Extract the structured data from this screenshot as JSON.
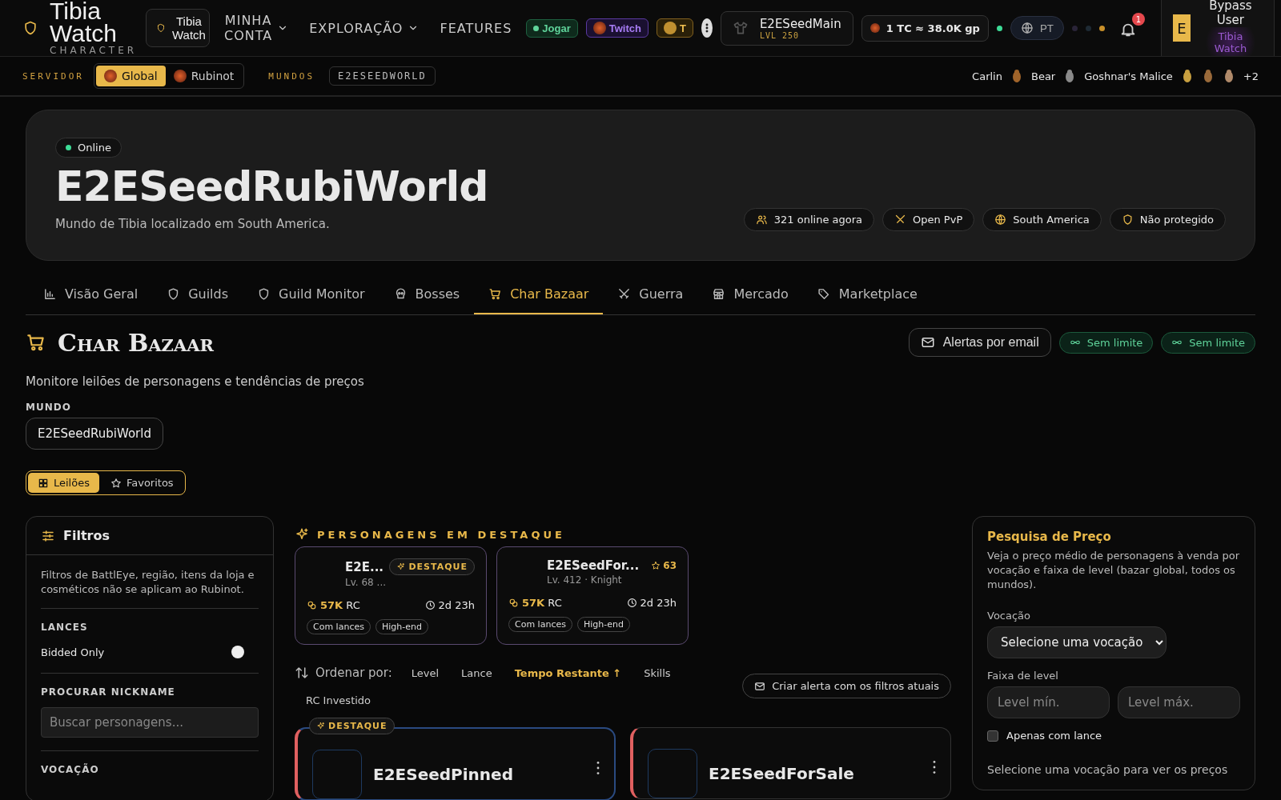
{
  "topbar": {
    "logo_title": "Tibia Watch",
    "logo_subtitle": "CHARACTER",
    "site_switch": "Tibia Watch",
    "nav": [
      {
        "label": "MINHA CONTA",
        "dropdown": true
      },
      {
        "label": "EXPLORAÇÃO",
        "dropdown": true
      },
      {
        "label": "FEATURES",
        "dropdown": false
      }
    ],
    "pills": [
      {
        "label": "Jogar",
        "kind": "jogar"
      },
      {
        "label": "Twitch",
        "kind": "twitch"
      },
      {
        "label": "T",
        "kind": "discord"
      }
    ],
    "character": {
      "name": "E2ESeedMain",
      "level": "LVL 250"
    },
    "tc_rate": "1 TC ≈ 38.0K gp",
    "language": "PT",
    "notifications": "1",
    "user": {
      "initial": "E",
      "name": "Bypass User",
      "brand": "Tibia Watch"
    }
  },
  "subbar": {
    "server_label": "SERVIDOR",
    "servers": [
      {
        "label": "Global",
        "selected": true
      },
      {
        "label": "Rubinot",
        "selected": false
      }
    ],
    "worlds_label": "MUNDOS",
    "world": "E2ESEEDWORLD",
    "bosses": [
      {
        "kind": "text",
        "name": "Carlin"
      },
      {
        "kind": "creature",
        "name": "Bear",
        "color": "#a0642a"
      },
      {
        "kind": "creature",
        "name": "Goshnar's Malice",
        "color": "#8a8a8a"
      },
      {
        "kind": "creature",
        "color": "#c8a040"
      },
      {
        "kind": "creature",
        "color": "#9a6a3a"
      },
      {
        "kind": "creature",
        "color": "#b08a6a"
      },
      {
        "kind": "text",
        "name": "+2"
      }
    ]
  },
  "hero": {
    "status": "Online",
    "title": "E2ESeedRubiWorld",
    "subtitle": "Mundo de Tibia localizado em South America.",
    "badges": [
      {
        "kind": "players",
        "label": "321 online agora"
      },
      {
        "kind": "pvp",
        "label": "Open PvP"
      },
      {
        "kind": "globe",
        "label": "South America"
      },
      {
        "kind": "shield",
        "label": "Não protegido"
      }
    ]
  },
  "tabs": [
    {
      "kind": "chart",
      "label": "Visão Geral",
      "selected": false
    },
    {
      "kind": "shield",
      "label": "Guilds",
      "selected": false
    },
    {
      "kind": "shield",
      "label": "Guild Monitor",
      "selected": false
    },
    {
      "kind": "skull",
      "label": "Bosses",
      "selected": false
    },
    {
      "kind": "cart",
      "label": "Char Bazaar",
      "selected": true
    },
    {
      "kind": "swords",
      "label": "Guerra",
      "selected": false
    },
    {
      "kind": "store",
      "label": "Mercado",
      "selected": false
    },
    {
      "kind": "tag",
      "label": "Marketplace",
      "selected": false
    }
  ],
  "bazaar": {
    "title": "Char Bazaar",
    "description": "Monitore leilões de personagens e tendências de preços",
    "email_button": "Alertas por email",
    "limits": [
      "Sem limite",
      "Sem limite"
    ],
    "world_label": "MUNDO",
    "world_value": "E2ESeedRubiWorld",
    "views": [
      {
        "kind": "grid",
        "label": "Leilões",
        "selected": true
      },
      {
        "kind": "star",
        "label": "Favoritos",
        "selected": false
      }
    ]
  },
  "filters": {
    "title": "Filtros",
    "note": "Filtros de BattlEye, região, itens da loja e cosméticos não se aplicam ao Rubinot.",
    "bids_label": "LANCES",
    "bidded_only": {
      "label": "Bidded Only",
      "on": false
    },
    "nickname_label": "PROCURAR NICKNAME",
    "nickname_placeholder": "Buscar personagens...",
    "vocation_label": "VOCAÇÃO"
  },
  "featured": {
    "heading": "PERSONAGENS EM DESTAQUE",
    "cards": [
      {
        "name": "E2E...",
        "info": "Lv. 68 ...",
        "badge": "DESTAQUE",
        "price": "57K",
        "currency": "RC",
        "time": "2d 23h",
        "tags": [
          "Com lances",
          "High-end"
        ]
      },
      {
        "name": "E2ESeedFor...",
        "info": "Lv. 412 · Knight",
        "score": "63",
        "price": "57K",
        "currency": "RC",
        "time": "2d 23h",
        "tags": [
          "Com lances",
          "High-end"
        ]
      }
    ]
  },
  "sort": {
    "label": "Ordenar por:",
    "options": [
      {
        "label": "Level",
        "selected": false
      },
      {
        "label": "Lance",
        "selected": false
      },
      {
        "label": "Tempo Restante ↑",
        "selected": true
      },
      {
        "label": "Skills",
        "selected": false
      },
      {
        "label": "RC Investido",
        "selected": false
      }
    ],
    "alert_button": "Criar alerta com os filtros atuais"
  },
  "listings": [
    {
      "name": "E2ESeedPinned",
      "badge": "DESTAQUE"
    },
    {
      "name": "E2ESeedForSale"
    }
  ],
  "price_research": {
    "title": "Pesquisa de Preço",
    "description": "Veja o preço médio de personagens à venda por vocação e faixa de level (bazar global, todos os mundos).",
    "vocation_label": "Vocação",
    "vocation_placeholder": "Selecione uma vocação",
    "level_label": "Faixa de level",
    "min_placeholder": "Level mín.",
    "max_placeholder": "Level máx.",
    "bid_only": {
      "label": "Apenas com lance",
      "checked": false
    },
    "hint": "Selecione uma vocação para ver os preços"
  }
}
